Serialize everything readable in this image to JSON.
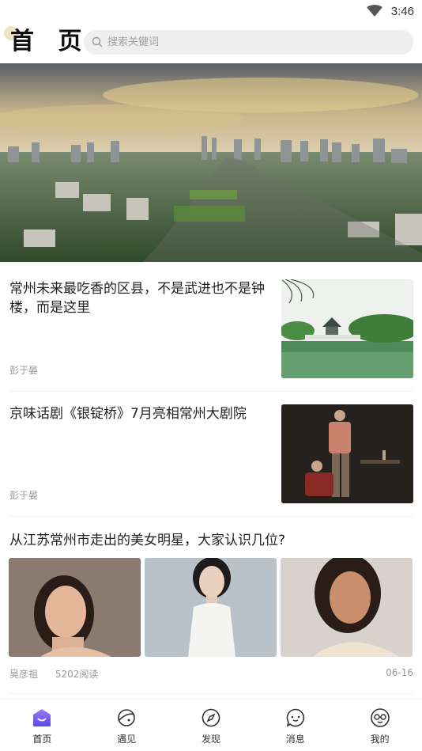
{
  "status_bar": {
    "time": "3:46",
    "icons": [
      "wifi-icon"
    ]
  },
  "header": {
    "title": "首 页",
    "search_placeholder": "搜索关键词"
  },
  "banner": {
    "image": "city-aerial-photo"
  },
  "feed": {
    "articles": [
      {
        "title": "常州未来最吃香的区县，不是武进也不是钟楼，而是这里",
        "author": "彭于晏",
        "thumbnail": "lake-pavilion-photo"
      },
      {
        "title": "京味话剧《银锭桥》7月亮相常州大剧院",
        "author": "彭于晏",
        "thumbnail": "stage-drama-photo"
      }
    ],
    "gallery_article": {
      "title": "从江苏常州市走出的美女明星，大家认识几位?",
      "author": "吴彦祖",
      "reads": "5202阅读",
      "date": "06-16",
      "images": [
        "actress-photo-1",
        "actress-photo-2",
        "actress-photo-3"
      ]
    }
  },
  "bottom_nav": {
    "items": [
      {
        "label": "首页",
        "icon": "home-icon",
        "active": true
      },
      {
        "label": "遇见",
        "icon": "planet-icon",
        "active": false
      },
      {
        "label": "发现",
        "icon": "compass-icon",
        "active": false
      },
      {
        "label": "消息",
        "icon": "message-icon",
        "active": false
      },
      {
        "label": "我的",
        "icon": "glasses-face-icon",
        "active": false
      }
    ]
  },
  "colors": {
    "accent": "#6b5cf0",
    "text": "#222222",
    "muted": "#999999",
    "search_bg": "#efefef"
  }
}
